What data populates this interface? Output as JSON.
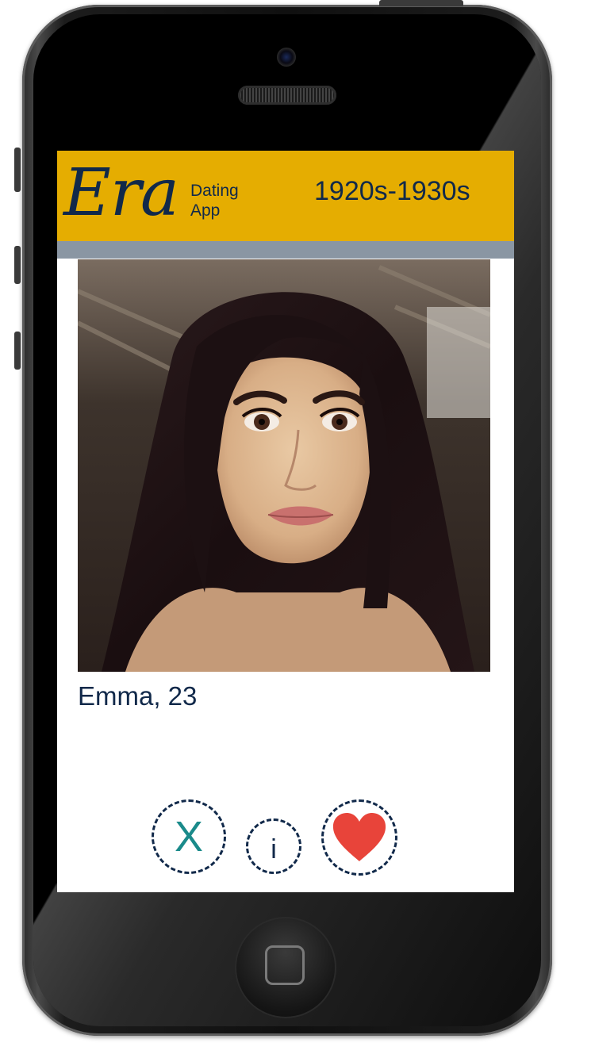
{
  "header": {
    "logo": "Era",
    "tagline_line1": "Dating",
    "tagline_line2": "App",
    "era_range": "1920s-1930s"
  },
  "profile": {
    "name_age": "Emma, 23",
    "photo_icon": "profile-photo"
  },
  "actions": {
    "pass_label": "X",
    "info_label": "i",
    "like_icon": "heart-icon"
  },
  "colors": {
    "header_bg": "#e5ad01",
    "header_band": "#8a96a3",
    "text_navy": "#11294a",
    "pass_teal": "#1a8a8a",
    "like_red": "#e8443a"
  }
}
